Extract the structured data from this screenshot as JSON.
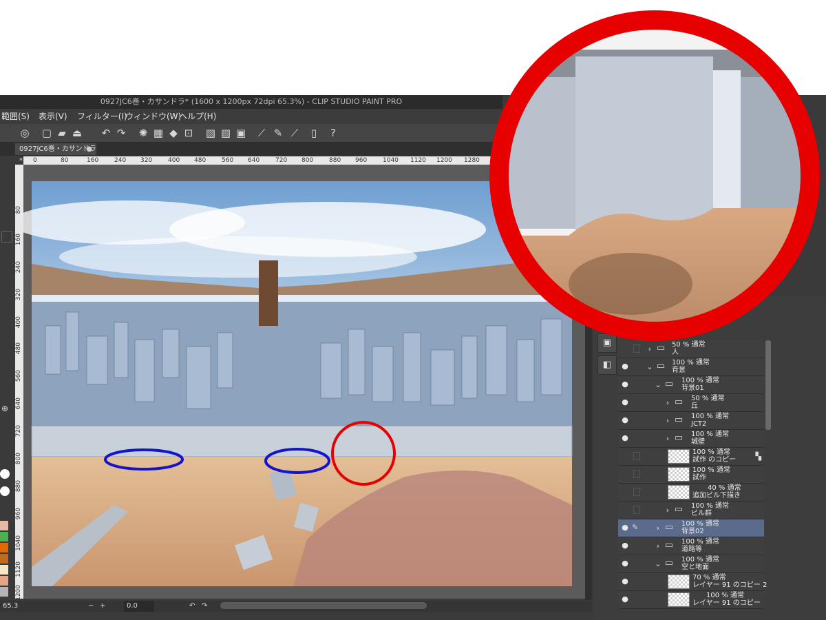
{
  "window": {
    "title": "0927JC6巻・カサンドラ* (1600 x 1200px 72dpi 65.3%)  - CLIP STUDIO PAINT PRO"
  },
  "menu": [
    {
      "label": "範囲(S)"
    },
    {
      "label": "表示(V)"
    },
    {
      "label": "フィルター(I)"
    },
    {
      "label": "ウィンドウ(W)"
    },
    {
      "label": "ヘルプ(H)"
    }
  ],
  "tab": {
    "label": "0927JC6巻・カサンドラ*",
    "close": "●"
  },
  "ruler_h": [
    "0",
    "80",
    "160",
    "240",
    "320",
    "400",
    "480",
    "560",
    "640",
    "720",
    "800",
    "880",
    "960",
    "1040",
    "1120",
    "1200",
    "1280"
  ],
  "ruler_v": [
    "80",
    "160",
    "240",
    "320",
    "400",
    "480",
    "560",
    "640",
    "720",
    "800",
    "880",
    "960",
    "1040",
    "1120",
    "1200"
  ],
  "status": {
    "zoom": "65.3",
    "angle": "0.0"
  },
  "layers": [
    {
      "line1": "50 % 通常",
      "line2": "人",
      "type": "folder",
      "collapsed": true,
      "indent": 0
    },
    {
      "line1": "100 % 通常",
      "line2": "背景",
      "type": "folder",
      "collapsed": false,
      "indent": 0
    },
    {
      "line1": "100 % 通常",
      "line2": "背景01",
      "type": "folder",
      "collapsed": false,
      "indent": 1
    },
    {
      "line1": "50 % 通常",
      "line2": "丘",
      "type": "folder",
      "collapsed": true,
      "indent": 2
    },
    {
      "line1": "100 % 通常",
      "line2": "JCT2",
      "type": "folder",
      "collapsed": true,
      "indent": 2
    },
    {
      "line1": "100 % 通常",
      "line2": "城壁",
      "type": "folder",
      "collapsed": true,
      "indent": 2
    },
    {
      "line1": "100 % 通常",
      "line2": "試作 のコピー",
      "type": "raster",
      "indent": 2
    },
    {
      "line1": "100 % 通常",
      "line2": "試作",
      "type": "raster",
      "indent": 2
    },
    {
      "line1": "40 % 通常",
      "line2": "追加ビル下描き",
      "type": "raster",
      "indent": 2
    },
    {
      "line1": "100 % 通常",
      "line2": "ビル群",
      "type": "folder",
      "collapsed": true,
      "indent": 2
    },
    {
      "line1": "100 % 通常",
      "line2": "背景02",
      "type": "folder",
      "collapsed": true,
      "indent": 1,
      "selected": true
    },
    {
      "line1": "100 % 通常",
      "line2": "道路等",
      "type": "folder",
      "collapsed": true,
      "indent": 1
    },
    {
      "line1": "100 % 通常",
      "line2": "空と地面",
      "type": "folder",
      "collapsed": false,
      "indent": 1
    },
    {
      "line1": "70 % 通常",
      "line2": "レイヤー 91 のコピー 2",
      "type": "raster",
      "indent": 2
    },
    {
      "line1": "100 % 通常",
      "line2": "レイヤー 91 のコピー",
      "type": "raster",
      "indent": 2
    }
  ],
  "annotations": {
    "blue_ellipse_color": "#1414c8",
    "red_circle_color": "#e60000"
  },
  "colors": {
    "panel": "#3d3d3d",
    "selected": "#5b6b8c",
    "sky": "#8fb4da",
    "sand": "#d9b08a"
  }
}
